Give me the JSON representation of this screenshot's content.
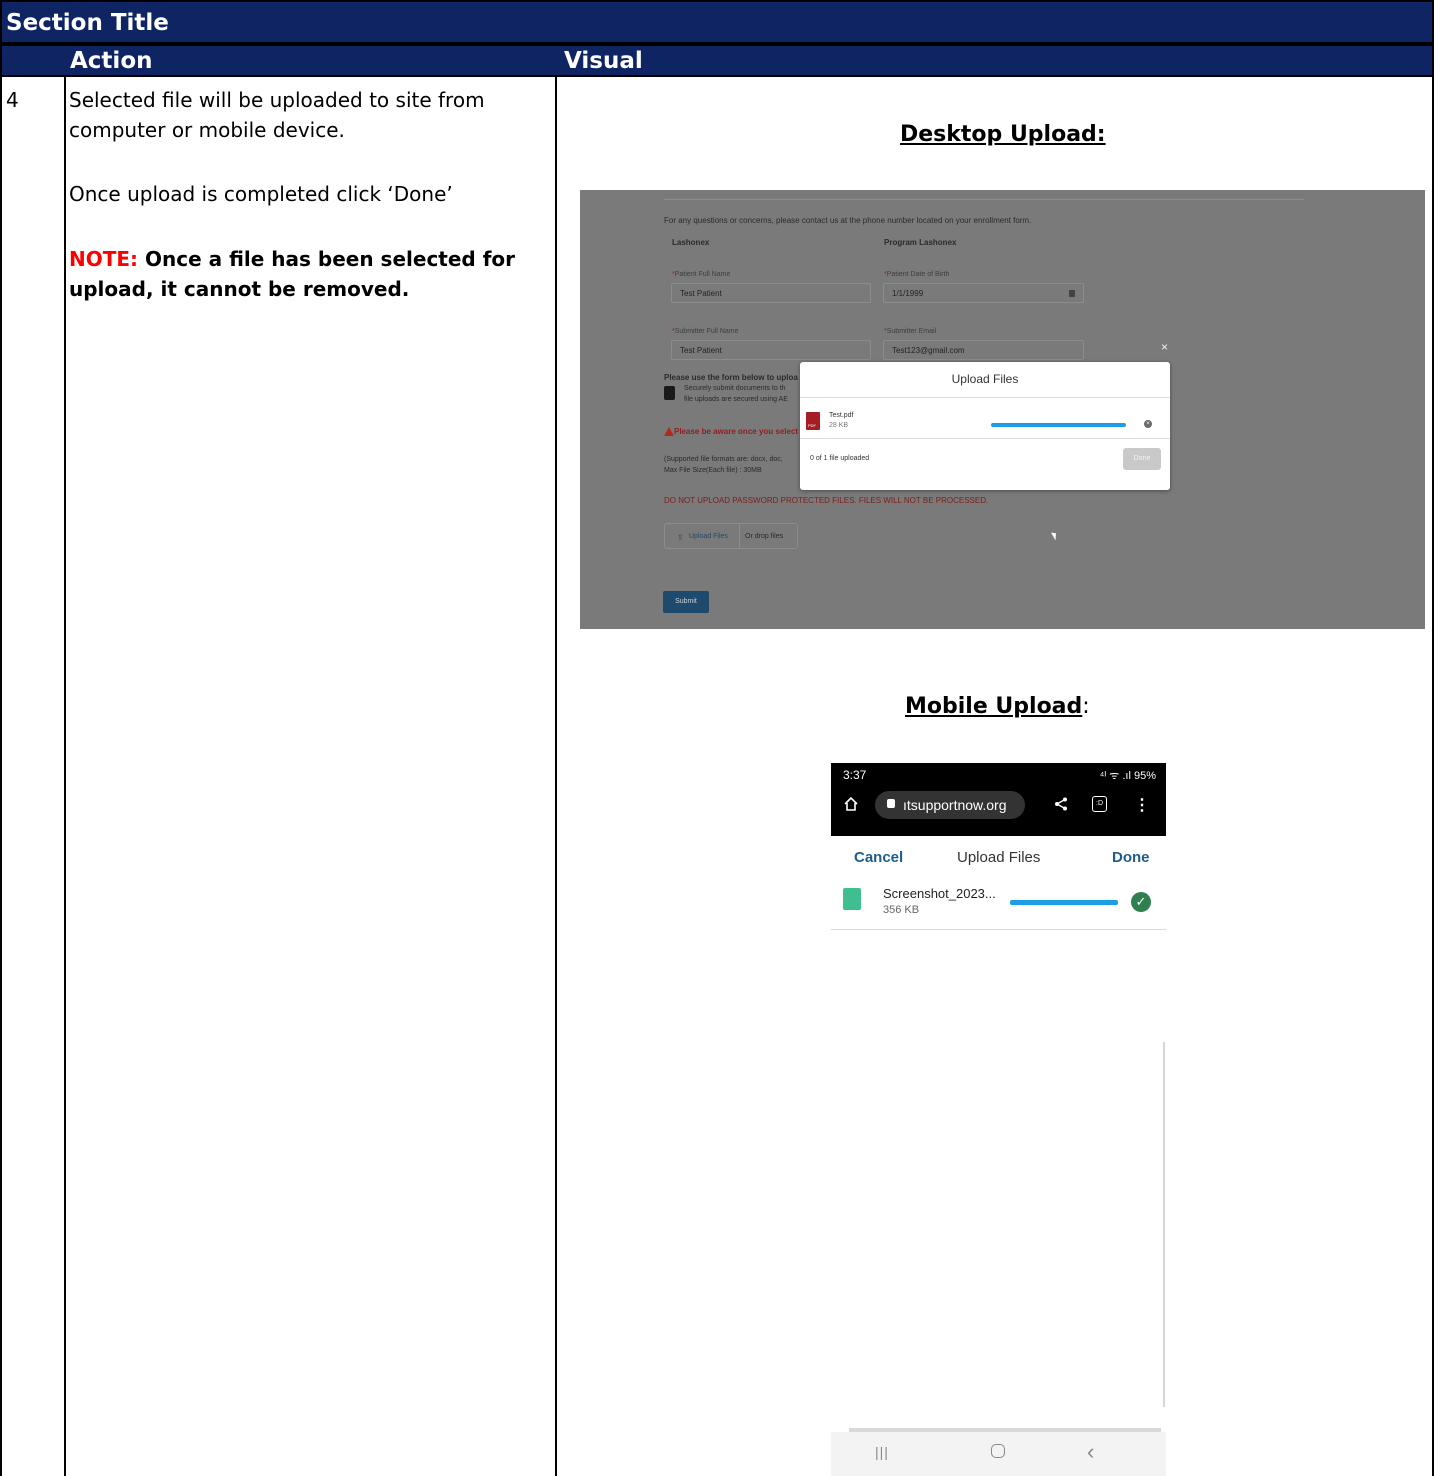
{
  "table": {
    "section_title": "Section Title",
    "col_action": "Action",
    "col_visual": "Visual",
    "row_number": "4"
  },
  "action": {
    "line1": "Selected file will be uploaded to site from",
    "line2": "computer or mobile device.",
    "line3": "Once upload is completed click ‘Done’",
    "note_label": "NOTE:",
    "note_text_1": "Once a file has been selected for",
    "note_text_2": "upload, it cannot be removed."
  },
  "visual": {
    "desktop_heading": "Desktop Upload:",
    "mobile_heading": "Mobile Upload",
    "mobile_heading_suffix": ":"
  },
  "desktop": {
    "intro": "For any questions or concerns, please contact us at the phone number located on your enrollment form.",
    "left_title": "Lashonex",
    "right_title": "Program Lashonex",
    "patient_name_label": "Patient Full Name",
    "patient_name_value": "Test Patient",
    "dob_label": "Patient Date of Birth",
    "dob_value": "1/1/1999",
    "submitter_name_label": "Submitter Full Name",
    "submitter_name_value": "Test Patient",
    "submitter_email_label": "Submitter Email",
    "submitter_email_value": "Test123@gmail.com",
    "instructions": "Please use the form below to uploa",
    "secure_1": "Securely submit documents to th",
    "secure_2": "file uploads are secured using AE",
    "warning": "Please be aware once you select",
    "formats_1": "(Supported file formats are: docx, doc,",
    "formats_2": "Max File Size(Each file) : 30MB",
    "no_password": "DO NOT UPLOAD PASSWORD PROTECTED FILES. FILES WILL NOT BE PROCESSED.",
    "upload_btn": "Upload Files",
    "drop_text": "Or drop files",
    "submit": "Submit",
    "modal": {
      "title": "Upload Files",
      "close": "×",
      "file_name": "Test.pdf",
      "file_size": "28 KB",
      "pdf_tag": "PDF",
      "progress": 1.0,
      "status": "0 of 1 file uploaded",
      "done": "Done"
    }
  },
  "mobile": {
    "time": "3:37",
    "status_icons": "⁴ᴵ ᯤ .ıl 95%",
    "url": "ıtsupportnow.org",
    "cancel": "Cancel",
    "title": "Upload Files",
    "done": "Done",
    "file_name": "Screenshot_2023...",
    "file_size": "356 KB",
    "progress": 1.0
  }
}
